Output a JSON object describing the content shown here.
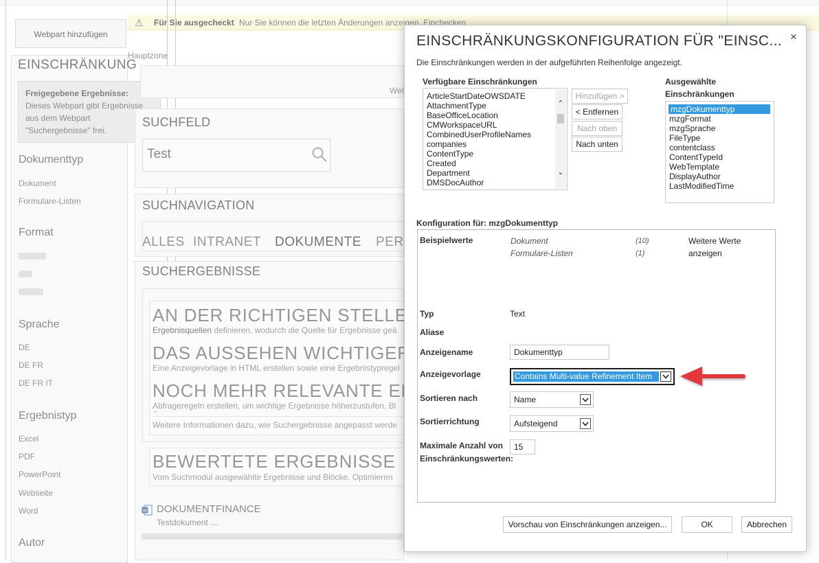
{
  "checkout_bar": {
    "title": "Für Sie ausgecheckt",
    "message": "Nur Sie können die letzten Änderungen anzeigen. Einchecken"
  },
  "page": {
    "add_webpart_label": "Webpart hinzufügen",
    "zone_label": "Hauptzone",
    "refinement_title": "EINSCHRÄNKUNG",
    "tooltip_title": "Freigegebene Ergebnisse:",
    "tooltip_text": "Dieses Webpart gibt Ergebnisse aus dem Webpart \"Suchergebnisse\" frei.",
    "refiners": [
      {
        "heading": "Dokumenttyp",
        "items": [
          "Dokument",
          "Formulare-Listen"
        ]
      },
      {
        "heading": "Format",
        "items": []
      },
      {
        "heading": "Sprache",
        "items": [
          "DE",
          "DE FR",
          "DE FR IT"
        ]
      },
      {
        "heading": "Ergebnistyp",
        "items": [
          "Excel",
          "PDF",
          "PowerPoint",
          "Webseite",
          "Word"
        ]
      },
      {
        "heading": "Autor",
        "items": []
      }
    ],
    "search_box_title": "SUCHFELD",
    "search_query": "Test",
    "welcome_partial": "Wel",
    "search_nav_title": "SUCHNAVIGATION",
    "nav_tabs": [
      "ALLES",
      "INTRANET",
      "DOKUMENTE",
      "PERS"
    ],
    "results_title": "SUCHERGEBNISSE",
    "promo_1_title": "AN DER RICHTIGEN STELLE SU",
    "promo_1_text_bold": "Ergebnisquellen",
    "promo_1_text": " definieren, wodurch die Quelle für Ergebnisse geä",
    "promo_2_title": "DAS AUSSEHEN WICHTIGER E",
    "promo_2_text": "Eine Anzeigevorlage in HTML erstellen sowie eine Ergebnistypregel",
    "promo_3_title": "NOCH MEHR RELEVANTE ERG",
    "promo_3_text": "Abfrageregeln erstellen, um wichtige Ergebnisse höherzustufen, Bl",
    "more_info_text": "Weitere Informationen dazu, wie Suchergebnisse angepasst werde",
    "rated_title": "BEWERTETE ERGEBNISSE",
    "rated_text": "Vom Suchmodul ausgewählte Ergebnisse und Blöcke. Optimieren",
    "result_title": "DOKUMENTFINANCE",
    "result_subtitle": "Testdokument ..."
  },
  "dialog": {
    "title": "EINSCHRÄNKUNGSKONFIGURATION FÜR \"EINSC...",
    "description": "Die Einschränkungen werden in der aufgeführten Reihenfolge angezeigt.",
    "available_label": "Verfügbare Einschränkungen",
    "available": [
      "ArticleStartDateOWSDATE",
      "AttachmentType",
      "BaseOfficeLocation",
      "CMWorkspaceURL",
      "CombinedUserProfileNames",
      "companies",
      "ContentType",
      "Created",
      "Department",
      "DMSDocAuthor"
    ],
    "btn_add": "Hinzufügen >",
    "btn_remove": "< Entfernen",
    "btn_up": "Nach oben",
    "btn_down": "Nach unten",
    "selected_label_1": "Ausgewählte",
    "selected_label_2": "Einschränkungen",
    "selected": [
      "mzgDokumenttyp",
      "mzgFormat",
      "mzgSprache",
      "FileType",
      "contentclass",
      "ContentTypeId",
      "WebTemplate",
      "DisplayAuthor",
      "LastModifiedTime"
    ],
    "config_for_label": "Konfiguration für: mzgDokumenttyp",
    "sample_values_label": "Beispielwerte",
    "sample_values": [
      {
        "value": "Dokument",
        "count": "(10)"
      },
      {
        "value": "Formulare-Listen",
        "count": "(1)"
      }
    ],
    "more_values_1": "Weitere Werte",
    "more_values_2": "anzeigen",
    "type_label": "Typ",
    "type_value": "Text",
    "aliases_label": "Aliase",
    "display_name_label": "Anzeigename",
    "display_name_value": "Dokumenttyp",
    "display_template_label": "Anzeigevorlage",
    "display_template_value": "Contains Multi-value Refinement Item",
    "sort_by_label": "Sortieren nach",
    "sort_by_value": "Name",
    "sort_dir_label": "Sortierrichtung",
    "sort_dir_value": "Aufsteigend",
    "max_label_1": "Maximale Anzahl von",
    "max_label_2": "Einschränkungswerten:",
    "max_value": "15",
    "btn_preview": "Vorschau von Einschränkungen anzeigen...",
    "btn_ok": "OK",
    "btn_cancel": "Abbrechen",
    "close_glyph": "×"
  },
  "colors": {
    "selection": "#3399e0",
    "annotation_arrow": "#e0393a",
    "checkout_bar": "#fbf7d4"
  }
}
